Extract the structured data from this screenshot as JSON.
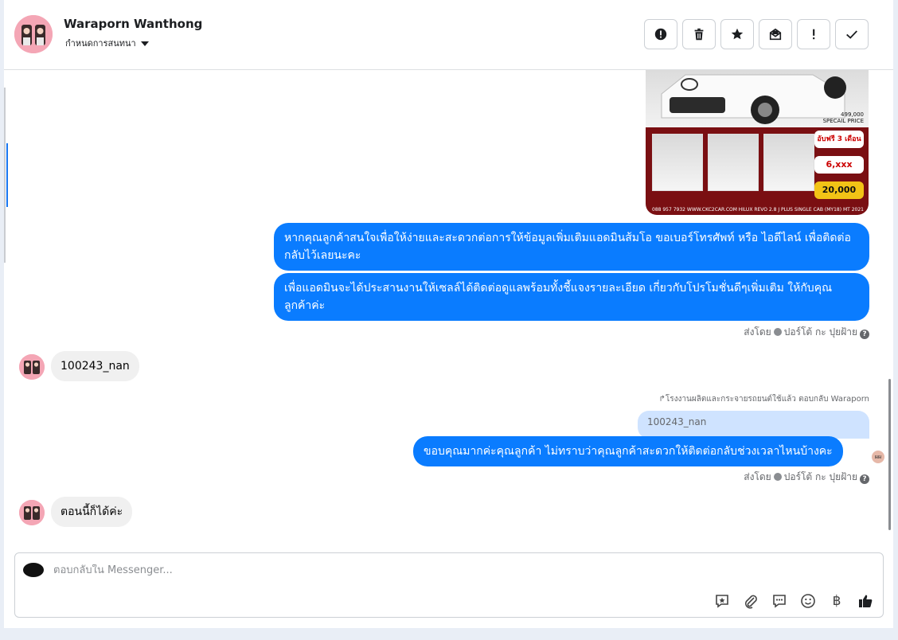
{
  "header": {
    "contact_name": "Waraporn Wanthong",
    "assign_label": "กำหนดการสนทนา",
    "actions": [
      "spam-icon",
      "trash-icon",
      "star-icon",
      "mark-unread-icon",
      "important-icon",
      "done-icon"
    ]
  },
  "promo_image": {
    "price": "499,000",
    "price_sub": "SPECAIL PRICE",
    "promo1": "อับฟรี 3 เดือน",
    "promo2": "6,xxx",
    "promo3": "20,000",
    "footer_left": "088 957 7932 WWW.CKC2CAR.COM",
    "footer_right": "HILUX REVO 2.8 J PLUS SINGLE CAB (MY18) MT 2021"
  },
  "messages": {
    "out1": "หากคุณลูกค้าสนใจเพื่อให้ง่ายและสะดวกต่อการให้ข้อมูลเพิ่มเติมแอดมินส้มโอ ขอเบอร์โทรศัพท์ หรือ ไอดีไลน์ เพื่อติดต่อกลับไว้เลยนะคะ",
    "out2": "เพื่อแอดมินจะได้ประสานงานให้เซลล์ได้ติดต่อดูแลพร้อมทั้งชี้แจงรายละเอียด เกี่ยวกับโปรโมชั่นดีๆเพิ่มเติม ให้กับคุณลูกค้าค่ะ",
    "sent_by_prefix": "ส่งโดย",
    "sent_by_name": "ปอร์โต้ กะ ปุยฝ้าย",
    "in1": "100243_nan",
    "reply_note": "โรงงานผลิตและกระจายรถยนต์ใช้แล้ว ตอบกลับ Waraporn",
    "quoted": "100243_nan",
    "out3": "ขอบคุณมากค่ะคุณลูกค้า ไม่ทราบว่าคุณลูกค้าสะดวกให้ติดต่อกลับช่วงเวลาไหนบ้างคะ",
    "seen_avatar": "ผผ",
    "in2": "ตอนนี้ก็ได้ค่ะ"
  },
  "composer": {
    "placeholder": "ตอบกลับใน Messenger...",
    "tools": [
      "saved-reply-icon",
      "attach-icon",
      "chat-icon",
      "emoji-icon",
      "baht-icon",
      "like-icon"
    ],
    "baht_symbol": "฿"
  },
  "colors": {
    "outgoing": "#0a7cff",
    "incoming": "#f0f0f0",
    "quoted": "#cfe3ff"
  }
}
